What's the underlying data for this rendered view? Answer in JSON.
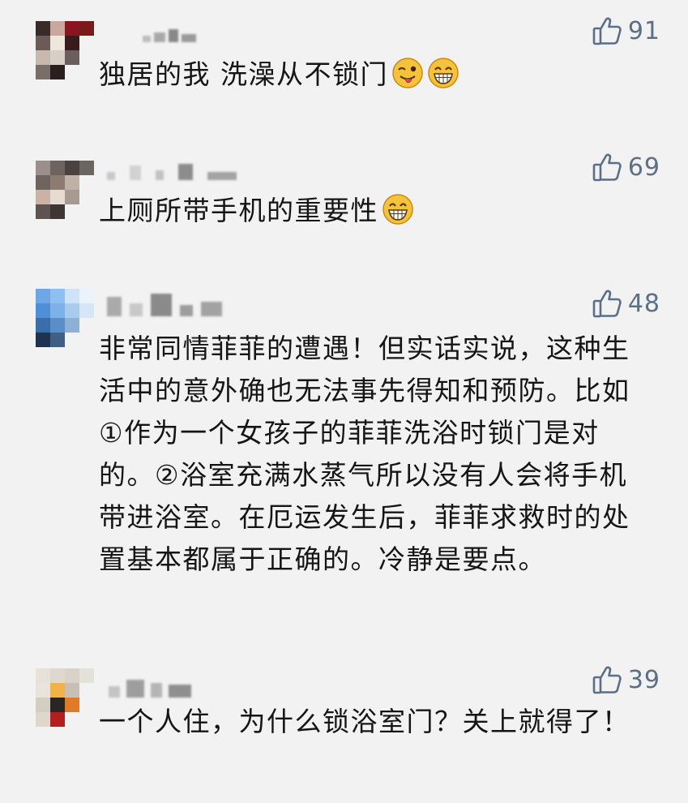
{
  "comments": [
    {
      "likes": "91",
      "text": "独居的我 洗澡从不锁门",
      "emojis": [
        "wink-tongue-emoji",
        "grin-emoji"
      ]
    },
    {
      "likes": "69",
      "text": "上厕所带手机的重要性",
      "emojis": [
        "grin-emoji"
      ]
    },
    {
      "likes": "48",
      "text": "非常同情菲菲的遭遇！但实话实说，这种生活中的意外确也无法事先得知和预防。比如①作为一个女孩子的菲菲洗浴时锁门是对的。②浴室充满水蒸气所以没有人会将手机带进浴室。在厄运发生后，菲菲求救时的处置基本都属于正确的。冷静是要点。",
      "emojis": []
    },
    {
      "likes": "39",
      "text": "一个人住，为什么锁浴室门？关上就得了！",
      "emojis": []
    }
  ],
  "colors": {
    "background": "#f2f2f2",
    "like_icon": "#5b6f86",
    "text": "#151515"
  },
  "icons": {
    "like": "thumbs-up-icon"
  }
}
